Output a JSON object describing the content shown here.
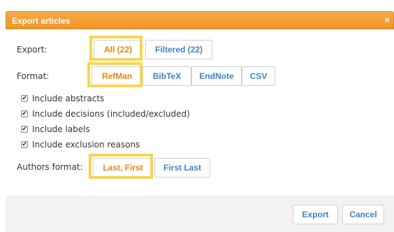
{
  "dialog": {
    "title": "Export articles",
    "close_glyph": "×"
  },
  "export": {
    "label": "Export:",
    "options": [
      "All (22)",
      "Filtered (22)"
    ],
    "selected": "All (22)"
  },
  "format": {
    "label": "Format:",
    "options": [
      "RefMan",
      "BibTeX",
      "EndNote",
      "CSV"
    ],
    "selected": "RefMan"
  },
  "checkboxes": [
    {
      "label": "Include abstracts",
      "checked": true
    },
    {
      "label": "Include decisions (included/excluded)",
      "checked": true
    },
    {
      "label": "Include labels",
      "checked": true
    },
    {
      "label": "Include exclusion reasons",
      "checked": true
    }
  ],
  "authors_format": {
    "label": "Authors format:",
    "options": [
      "Last, First",
      "First Last"
    ],
    "selected": "Last, First"
  },
  "footer": {
    "export_label": "Export",
    "cancel_label": "Cancel"
  },
  "colors": {
    "accent": "#f0941f",
    "link": "#3b83c8",
    "highlight": "#f7d64c"
  },
  "icons": {
    "check": "✔"
  }
}
